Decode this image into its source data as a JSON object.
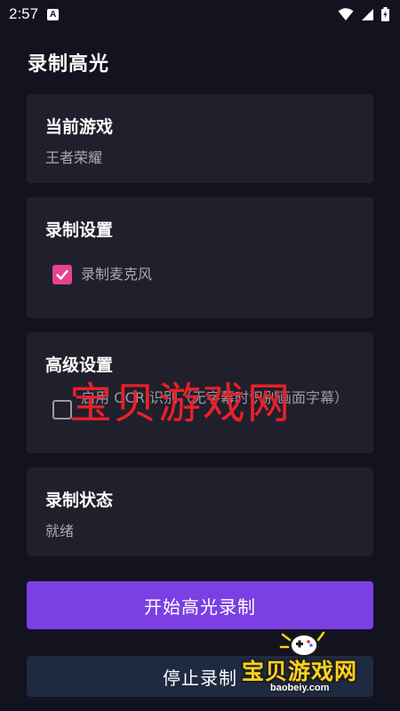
{
  "status_bar": {
    "time": "2:57",
    "notification_icon_letter": "A",
    "icons": [
      "wifi-icon",
      "signal-icon",
      "battery-icon"
    ]
  },
  "page_title": "录制高光",
  "current_game": {
    "title": "当前游戏",
    "value": "王者荣耀"
  },
  "record_settings": {
    "title": "录制设置",
    "mic_checkbox": {
      "label": "录制麦克风",
      "checked": true
    }
  },
  "advanced_settings": {
    "title": "高级设置",
    "ocr_checkbox": {
      "label": "启用 OCR 识别（无字幕时识别画面字幕）",
      "checked": false
    }
  },
  "record_status": {
    "title": "录制状态",
    "value": "就绪"
  },
  "buttons": {
    "start": "开始高光录制",
    "stop": "停止录制"
  },
  "watermark": {
    "main_text": "宝贝游戏网",
    "logo_text": "宝贝游戏网",
    "logo_url": "baobeiy.com"
  },
  "colors": {
    "background": "#13131f",
    "card": "#20202c",
    "accent_pink": "#e5428f",
    "primary_button": "#7b3fe4",
    "secondary_button": "#1e2a40"
  }
}
